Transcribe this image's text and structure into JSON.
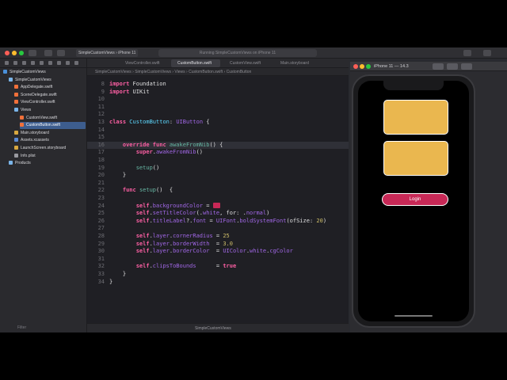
{
  "toolbar": {
    "scheme": "SimpleCustomViews",
    "device": "iPhone 11",
    "activity": "Running SimpleCustomViews on iPhone 11"
  },
  "tabs": [
    "ViewController.swift",
    "CustomButton.swift",
    "CustomView.swift",
    "Main.storyboard"
  ],
  "jumpbar": "SimpleCustomViews  ›  SimpleCustomViews  ›  Views  ›  CustomButton.swift  ›  CustomButton",
  "sidebar": {
    "items": [
      {
        "label": "SimpleCustomViews",
        "level": 0,
        "icon": "project-icon"
      },
      {
        "label": "SimpleCustomViews",
        "level": 1,
        "icon": "folder-icon"
      },
      {
        "label": "AppDelegate.swift",
        "level": 2,
        "icon": "swift-file-icon"
      },
      {
        "label": "SceneDelegate.swift",
        "level": 2,
        "icon": "swift-file-icon"
      },
      {
        "label": "ViewController.swift",
        "level": 2,
        "icon": "swift-file-icon"
      },
      {
        "label": "Views",
        "level": 2,
        "icon": "folder-icon"
      },
      {
        "label": "CustomView.swift",
        "level": 3,
        "icon": "swift-file-icon"
      },
      {
        "label": "CustomButton.swift",
        "level": 3,
        "icon": "swift-file-icon",
        "selected": true
      },
      {
        "label": "Main.storyboard",
        "level": 2,
        "icon": "storyboard-icon"
      },
      {
        "label": "Assets.xcassets",
        "level": 2,
        "icon": "assets-icon"
      },
      {
        "label": "LaunchScreen.storyboard",
        "level": 2,
        "icon": "storyboard-icon"
      },
      {
        "label": "Info.plist",
        "level": 2,
        "icon": "plist-icon"
      },
      {
        "label": "Products",
        "level": 1,
        "icon": "folder-icon"
      }
    ],
    "filter_placeholder": "Filter"
  },
  "editor": {
    "current_line": 16,
    "lines": [
      {
        "n": "8",
        "html": "<span class=\"kw\">import</span> Foundation"
      },
      {
        "n": "9",
        "html": "<span class=\"kw\">import</span> UIKit"
      },
      {
        "n": "10",
        "html": ""
      },
      {
        "n": "11",
        "html": ""
      },
      {
        "n": "12",
        "html": ""
      },
      {
        "n": "13",
        "html": "<span class=\"kw\">class</span> <span class=\"ty\">CustomButton</span>: <span class=\"ac\">UIButton</span> {"
      },
      {
        "n": "14",
        "html": ""
      },
      {
        "n": "15",
        "html": ""
      },
      {
        "n": "16",
        "html": "    <span class=\"kw\">override</span> <span class=\"kw\">func</span> <span class=\"fn\">awakeFromNib</span>() {"
      },
      {
        "n": "17",
        "html": "        <span class=\"kw\">super</span>.<span class=\"ac\">awakeFromNib</span>()"
      },
      {
        "n": "18",
        "html": ""
      },
      {
        "n": "19",
        "html": "        <span class=\"fn\">setup</span>()"
      },
      {
        "n": "20",
        "html": "    }"
      },
      {
        "n": "21",
        "html": ""
      },
      {
        "n": "22",
        "html": "    <span class=\"kw\">func</span> <span class=\"fn\">setup</span>()  {"
      },
      {
        "n": "23",
        "html": ""
      },
      {
        "n": "24",
        "html": "        <span class=\"kw\">self</span>.<span class=\"ac\">backgroundColor</span> = <span class=\"swatch\"></span>"
      },
      {
        "n": "25",
        "html": "        <span class=\"kw\">self</span>.<span class=\"ac\">setTitleColor</span>(.<span class=\"ac\">white</span>, for: .<span class=\"ac\">normal</span>)"
      },
      {
        "n": "26",
        "html": "        <span class=\"kw\">self</span>.<span class=\"ac\">titleLabel</span>?.<span class=\"ac\">font</span> = <span class=\"ac\">UIFont</span>.<span class=\"ac\">boldSystemFont</span>(ofSize: <span class=\"num\">20</span>)"
      },
      {
        "n": "27",
        "html": ""
      },
      {
        "n": "28",
        "html": "        <span class=\"kw\">self</span>.<span class=\"ac\">layer</span>.<span class=\"ac\">cornerRadius</span> = <span class=\"num\">25</span>"
      },
      {
        "n": "29",
        "html": "        <span class=\"kw\">self</span>.<span class=\"ac\">layer</span>.<span class=\"ac\">borderWidth</span>  = <span class=\"num\">3.0</span>"
      },
      {
        "n": "30",
        "html": "        <span class=\"kw\">self</span>.<span class=\"ac\">layer</span>.<span class=\"ac\">borderColor</span>  = <span class=\"ac\">UIColor</span>.<span class=\"ac\">white</span>.<span class=\"ac\">cgColor</span>"
      },
      {
        "n": "31",
        "html": ""
      },
      {
        "n": "32",
        "html": "        <span class=\"kw\">self</span>.<span class=\"ac\">clipsToBounds</span>      = <span class=\"kw\">true</span>"
      },
      {
        "n": "33",
        "html": "    }"
      },
      {
        "n": "34",
        "html": "}"
      }
    ]
  },
  "statusbar": {
    "target": "SimpleCustomViews"
  },
  "simulator": {
    "title": "iPhone 11 — 14.3",
    "login_label": "Login",
    "card_color": "#eab74f",
    "button_color": "#c72856"
  }
}
